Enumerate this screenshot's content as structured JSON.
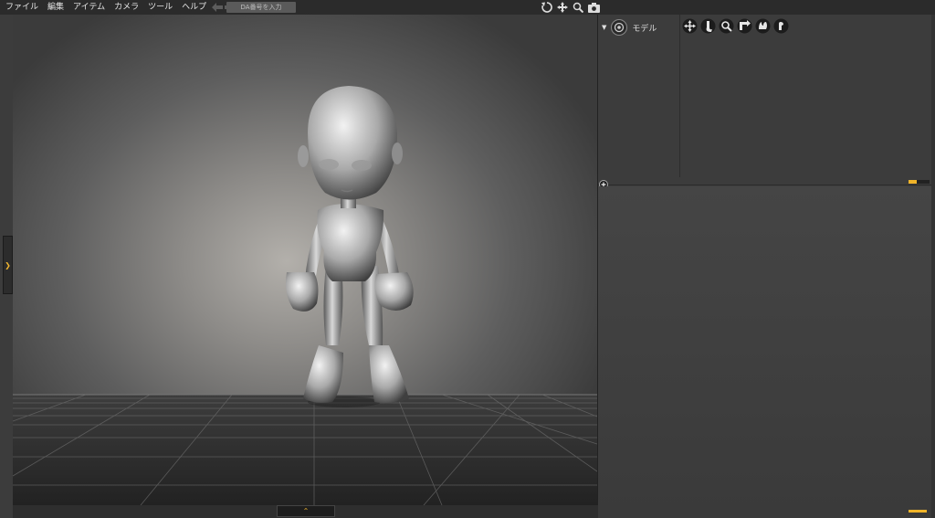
{
  "menubar": {
    "items": [
      "ファイル",
      "編集",
      "アイテム",
      "カメラ",
      "ツール",
      "ヘルプ"
    ],
    "back_icon": "arrow-left-icon",
    "forward_icon": "arrow-right-icon",
    "camera_icon": "camera-group-icon",
    "search_placeholder": "DA番号を入力"
  },
  "viewport_tools": [
    "rotate-icon",
    "move-icon",
    "zoom-icon",
    "screenshot-icon"
  ],
  "scene": {
    "root_label": "モデル",
    "tool_icons": [
      "translate-tool-icon",
      "anchor-tool-icon",
      "zoom-tool-icon",
      "reset-tool-icon",
      "wave-tool-icon",
      "hand-tool-icon"
    ]
  },
  "colors": {
    "accent": "#f0b429",
    "panel_bg": "#3c3c3c",
    "menubar_bg": "#2b2b2b"
  }
}
